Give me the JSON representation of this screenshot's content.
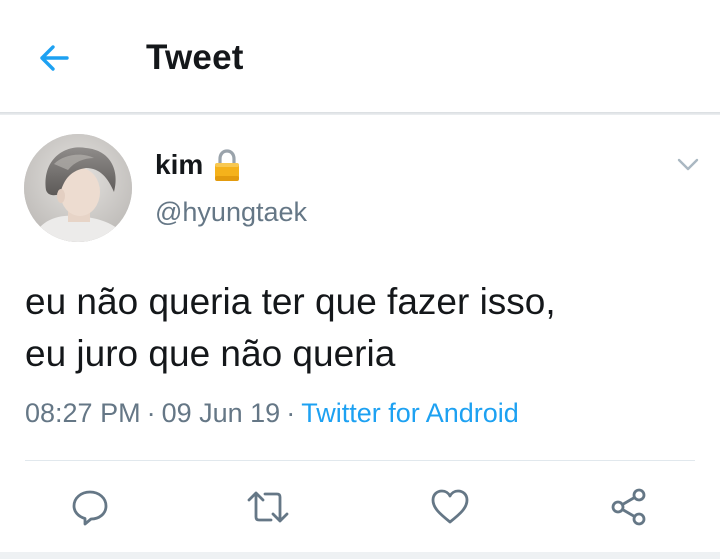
{
  "header": {
    "title": "Tweet",
    "back_icon": "arrow-left-icon"
  },
  "tweet": {
    "author_name": "kim",
    "author_handle": "@hyungtaek",
    "protected_icon": "lock-icon",
    "text": "eu não queria ter que fazer isso,\neu juro que não queria",
    "time": "08:27 PM",
    "date": "09 Jun 19",
    "source": "Twitter for Android",
    "separator": "·"
  },
  "actions": [
    {
      "name": "reply",
      "icon": "reply-icon"
    },
    {
      "name": "retweet",
      "icon": "retweet-icon"
    },
    {
      "name": "like",
      "icon": "heart-icon"
    },
    {
      "name": "share",
      "icon": "share-icon"
    }
  ],
  "colors": {
    "accent": "#1da1f2",
    "text_primary": "#14171a",
    "text_secondary": "#657786",
    "icon_gray": "#657786",
    "divider": "#e1e8ed",
    "lock_gold": "#f5b21b"
  }
}
